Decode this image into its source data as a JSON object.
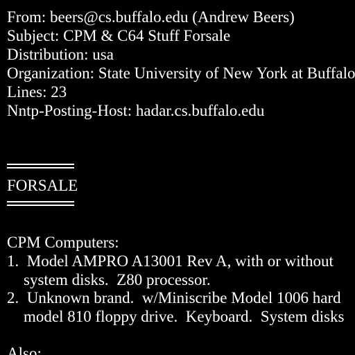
{
  "header": {
    "from": "From: beers@cs.buffalo.edu (Andrew Beers)",
    "subject": "Subject: CPM & C64 Stuff Forsale",
    "distribution": "Distribution: usa",
    "organization": "Organization: State University of New York at Buffalo",
    "lines": "Lines: 23",
    "nntp_host": "Nntp-Posting-Host: hadar.cs.buffalo.edu"
  },
  "body": {
    "forsale_heading": "FORSALE",
    "section_title": "CPM Computers:",
    "item1_line1": "1.  Model AMPRO A13001 Rev A, with or without",
    "item1_line2": "system disks.  Z80 processor.",
    "item2_line1": "2.  Unknown brand.  w/Miniscribe Model 1006 hard",
    "item2_line2": "model 810 floppy drive.  Keyboard.  System disks",
    "also": "Also:"
  },
  "colors": {
    "background": "#000000",
    "text": "#ffffff"
  }
}
